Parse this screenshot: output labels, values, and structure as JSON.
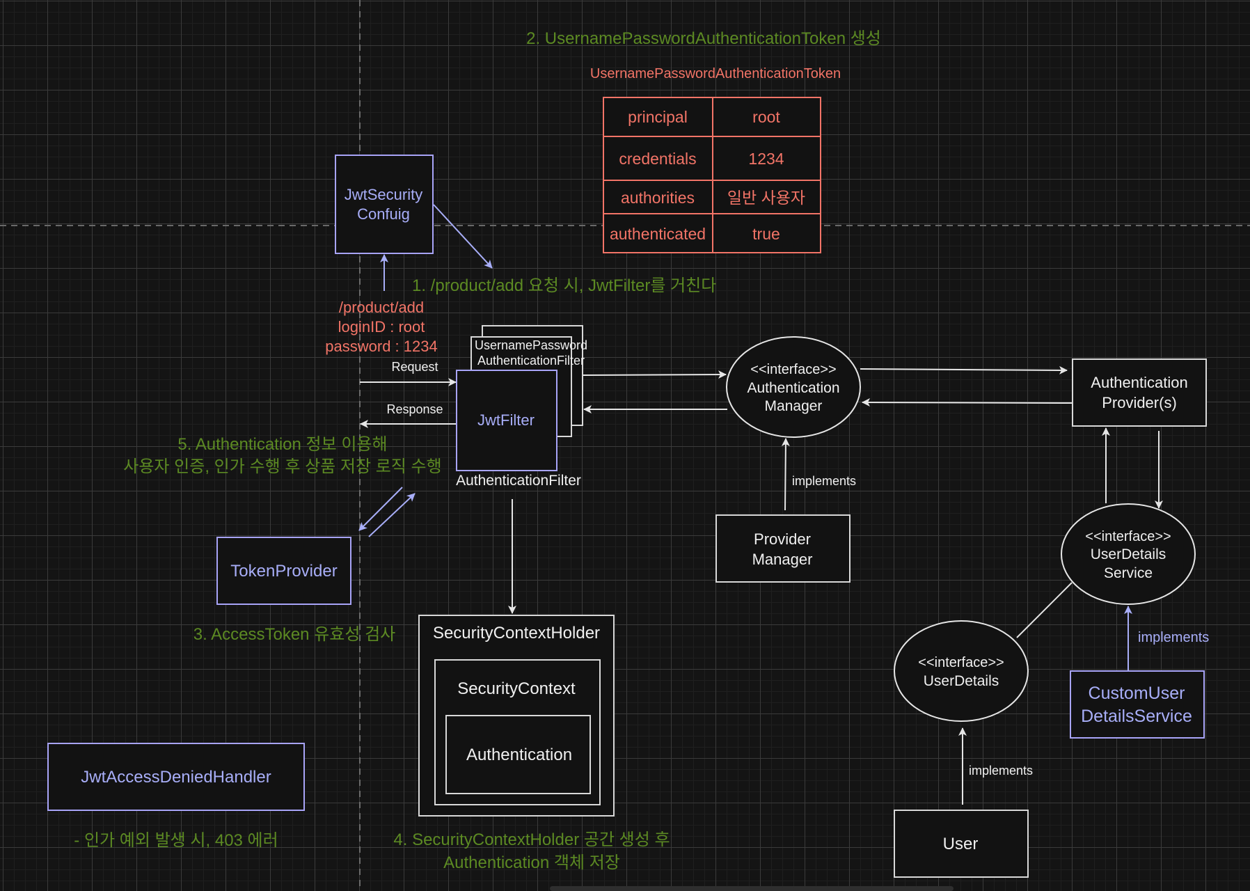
{
  "colors": {
    "background": "#141414",
    "white_stroke": "#d9d9d9",
    "custom_component": "#a8aef8",
    "token_data": "#f27467",
    "annotation": "#5c8a23"
  },
  "annotations": {
    "step1": "1. /product/add 요청 시, JwtFilter를 거친다",
    "step2": "2. UsernamePasswordAuthenticationToken 생성",
    "step3": "3. AccessToken 유효성 검사",
    "step4_line1": "4. SecurityContextHolder 공간 생성 후",
    "step4_line2": "Authentication 객체 저장",
    "step5_line1": "5. Authentication 정보 이용해",
    "step5_line2": "사용자 인증, 인가 수행 후 상품 저장 로직 수행",
    "access_denied_note": "- 인가 예외 발생 시, 403 에러"
  },
  "token_table": {
    "title": "UsernamePasswordAuthenticationToken",
    "rows": [
      {
        "key": "principal",
        "value": "root"
      },
      {
        "key": "credentials",
        "value": "1234"
      },
      {
        "key": "authorities",
        "value": "일반 사용자"
      },
      {
        "key": "authenticated",
        "value": "true"
      }
    ]
  },
  "request_info": {
    "line1": "/product/add",
    "line2": "loginID : root",
    "line3": "password : 1234"
  },
  "nodes": {
    "jwt_security_config": {
      "line1": "JwtSecurity",
      "line2": "Confuig"
    },
    "username_password_filter": {
      "line1": "UsernamePassword",
      "line2": "AuthenticationFilter"
    },
    "jwt_filter": "JwtFilter",
    "authentication_filter_label": "AuthenticationFilter",
    "token_provider": "TokenProvider",
    "jwt_access_denied_handler": "JwtAccessDeniedHandler",
    "security_context_holder": "SecurityContextHolder",
    "security_context": "SecurityContext",
    "authentication": "Authentication",
    "authentication_manager": {
      "stereotype": "<<interface>>",
      "line1": "Authentication",
      "line2": "Manager"
    },
    "provider_manager": {
      "line1": "Provider",
      "line2": "Manager"
    },
    "authentication_providers": {
      "line1": "Authentication",
      "line2": "Provider(s)"
    },
    "user_details_service": {
      "stereotype": "<<interface>>",
      "line1": "UserDetails",
      "line2": "Service"
    },
    "user_details": {
      "stereotype": "<<interface>>",
      "line1": "UserDetails"
    },
    "custom_user_details_service": {
      "line1": "CustomUser",
      "line2": "DetailsService"
    },
    "user": "User"
  },
  "edge_labels": {
    "request": "Request",
    "response": "Response",
    "implements_provider_manager": "implements",
    "implements_custom_uds": "implements",
    "implements_user": "implements"
  }
}
